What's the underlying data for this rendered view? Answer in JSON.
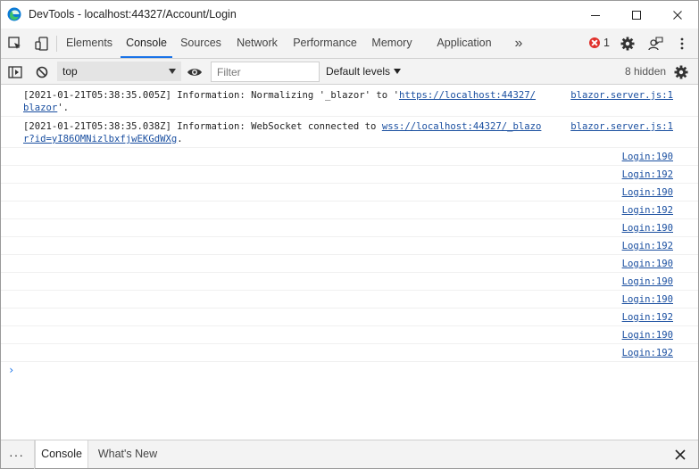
{
  "window": {
    "title": "DevTools - localhost:44327/Account/Login"
  },
  "tabs": [
    {
      "label": "Elements",
      "active": false
    },
    {
      "label": "Console",
      "active": true
    },
    {
      "label": "Sources",
      "active": false
    },
    {
      "label": "Network",
      "active": false
    },
    {
      "label": "Performance",
      "active": false
    },
    {
      "label": "Memory",
      "active": false
    },
    {
      "label": "Application",
      "active": false
    }
  ],
  "tabbar": {
    "more_tabs": "»",
    "error_count": "1"
  },
  "console_toolbar": {
    "context": "top",
    "filter_placeholder": "Filter",
    "levels_label": "Default levels",
    "hidden_count": "8 hidden"
  },
  "messages": {
    "m1": {
      "prefix": "[2021-01-21T05:38:35.005Z] Information: Normalizing '_blazor' to '",
      "link1": "https://localhost:44327/",
      "link2": "blazor",
      "suffix": "'.",
      "source": "blazor.server.js:1"
    },
    "m2": {
      "prefix": "[2021-01-21T05:38:35.038Z] Information: WebSocket connected to ",
      "link1": "wss://localhost:44327/_blazo",
      "link2": "r?id=yI86OMNizlbxfjwEKGdWXg",
      "suffix": ".",
      "source": "blazor.server.js:1"
    },
    "logins": [
      "Login:190",
      "Login:192",
      "Login:190",
      "Login:192",
      "Login:190",
      "Login:192",
      "Login:190",
      "Login:190",
      "Login:190",
      "Login:192",
      "Login:190",
      "Login:192"
    ]
  },
  "prompt": "›",
  "drawer": {
    "menu": "···",
    "tabs": [
      {
        "label": "Console",
        "active": true
      },
      {
        "label": "What's New",
        "active": false
      }
    ]
  },
  "colors": {
    "accent": "#1a73e8",
    "link": "#1a4fa0",
    "error": "#e0312c",
    "toolbar_bg": "#f3f3f3"
  }
}
